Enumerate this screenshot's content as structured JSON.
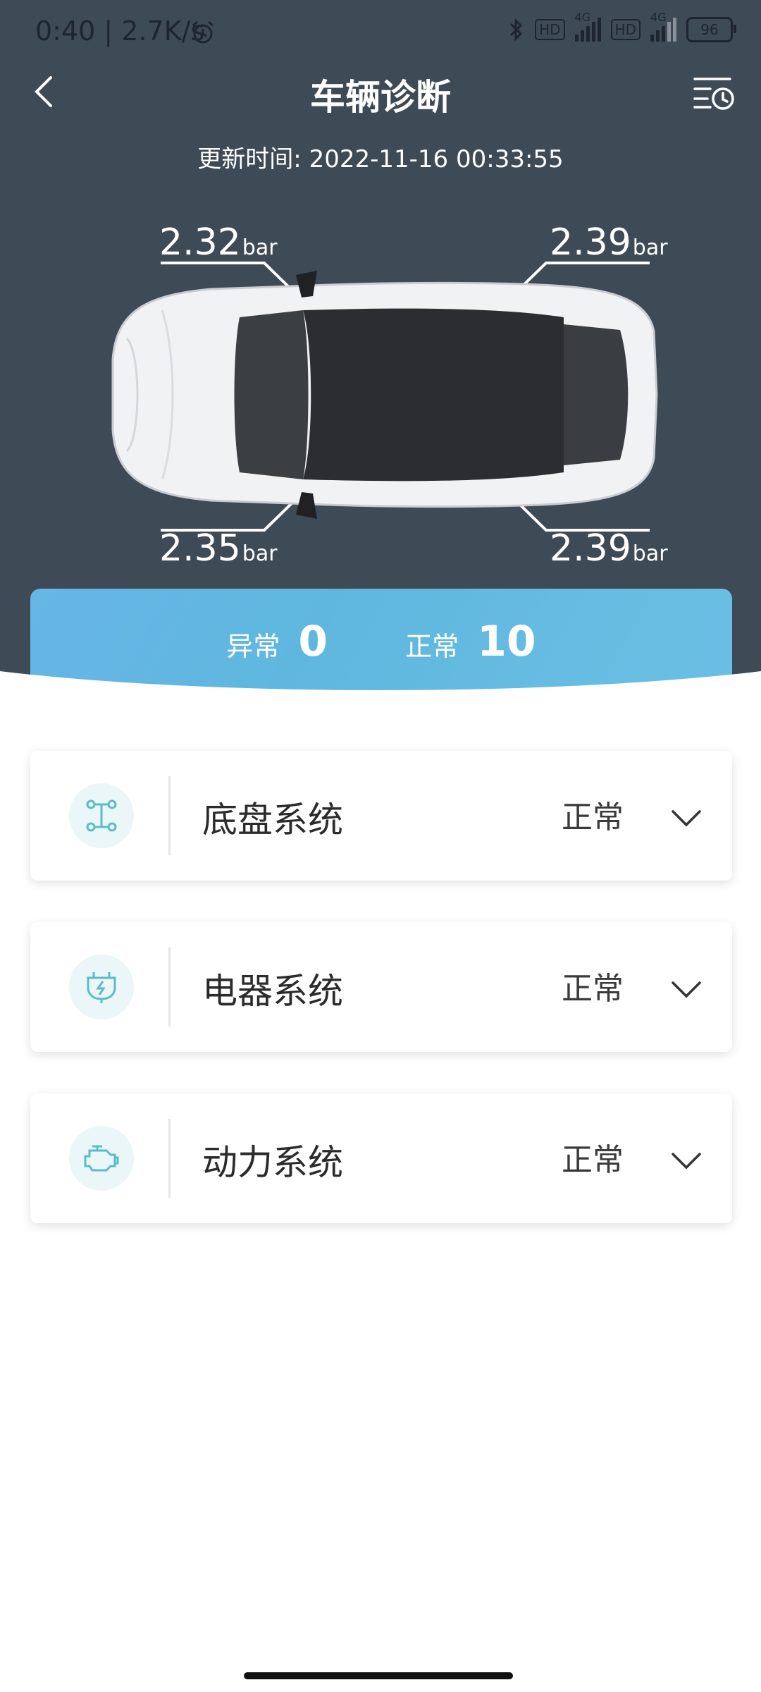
{
  "status_bar": {
    "time_speed": "0:40 | 2.7K/s",
    "hd1": "HD",
    "net1": "4G",
    "hd2": "HD",
    "net2": "4G",
    "battery": "96"
  },
  "header": {
    "title": "车辆诊断",
    "update_label": "更新时间:",
    "update_time": "2022-11-16 00:33:55"
  },
  "tires": {
    "front_left": {
      "value": "2.32",
      "unit": "bar"
    },
    "front_right": {
      "value": "2.39",
      "unit": "bar"
    },
    "rear_left": {
      "value": "2.35",
      "unit": "bar"
    },
    "rear_right": {
      "value": "2.39",
      "unit": "bar"
    }
  },
  "summary": {
    "abnormal_label": "异常",
    "abnormal_count": "0",
    "normal_label": "正常",
    "normal_count": "10"
  },
  "systems": [
    {
      "name": "底盘系统",
      "status": "正常",
      "icon": "chassis-icon"
    },
    {
      "name": "电器系统",
      "status": "正常",
      "icon": "electrical-icon"
    },
    {
      "name": "动力系统",
      "status": "正常",
      "icon": "engine-icon"
    }
  ],
  "colors": {
    "header_bg": "#3e4a56",
    "summary_blue": "#5fb7df",
    "icon_teal": "#5bbcc8"
  }
}
